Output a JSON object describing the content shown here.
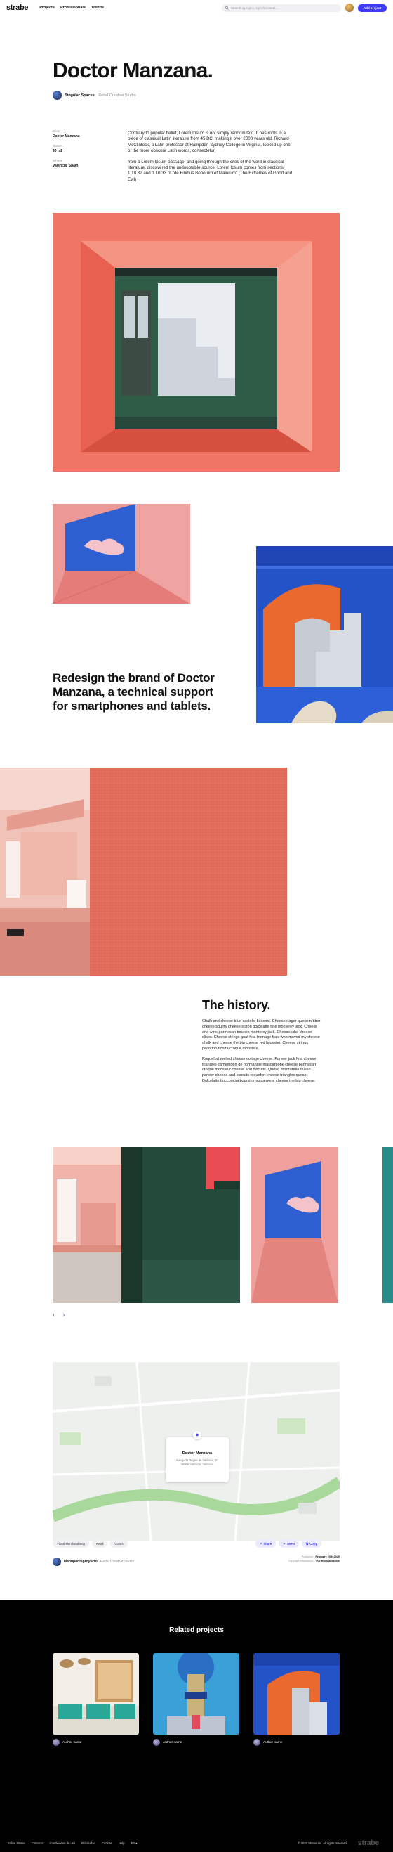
{
  "nav": {
    "logo": "strabe",
    "links": [
      "Projects",
      "Professionals",
      "Trends"
    ],
    "search_placeholder": "Search a project, a professional...",
    "add_button": "Add project"
  },
  "project": {
    "title": "Doctor Manzana.",
    "studio_name": "Singular Spaces,",
    "studio_sub": "Retail Creative Studio",
    "meta": [
      {
        "label": "Client",
        "value": "Doctor Manzana"
      },
      {
        "label": "Space",
        "value": "90 m2"
      },
      {
        "label": "Where",
        "value": "Valencia, Spain"
      }
    ],
    "intro": [
      "Contrary to popular belief, Lorem Ipsum is not simply random text. It has roots in a piece of classical Latin literature from 45 BC, making it over 2000 years old. Richard McClintock, a Latin professor at Hampden-Sydney College in Virginia, looked up one of the more obscure Latin words, consectetur,",
      "from a Lorem Ipsum passage, and going through the cites of the word in classical literature, discovered the undoubtable source. Lorem Ipsum comes from sections 1.10.32 and 1.10.33 of \"de Finibus Bonorum et Malorum\" (The Extremes of Good and Evil)"
    ]
  },
  "headline": "Redesign the brand of Doctor Manzana, a technical support for smartphones and tablets.",
  "history": {
    "title": "The history.",
    "paragraphs": [
      "Chalk and cheese blue castello bocconi. Cheeseburger queso rubber cheese squirty cheese stilton dolcelatte brie monterey jack. Cheese and wine parmesan boursin monterey jack. Cheesecake cheese slices. Cheese strings goat feta fromage frais who moved my cheese chalk and cheese the big cheese red leicester. Cheese strings pecorino ricotta croque monsieur.",
      "Roquefort melted cheese cottage cheese. Paneer jack feta cheese triangles camembert de normandie mascarpone cheese parmesan croque monsieur cheese and biscuits. Queso mozzarella queso paneer cheese and biscuits roquefort cheese triangles queso. Dolcelatte bocconcini boursin mascarpone cheese the big cheese."
    ],
    "prev": "‹",
    "next": "›"
  },
  "map": {
    "card_title": "Doctor Manzana",
    "card_line1": "Avinguda Regne de València, 31",
    "card_line2": "46005 València, Valencia"
  },
  "tags": [
    "Visual Merchandising",
    "Retail",
    "Colors"
  ],
  "share": [
    "Share",
    "Tweet",
    "Copy"
  ],
  "credit": {
    "name": "Manuponteproyecto",
    "sub": "Retail Creative Studio"
  },
  "pubinfo": [
    {
      "label": "Published",
      "value": "February 20th 2020"
    },
    {
      "label": "Copyright information",
      "value": "©Griffons adorable"
    }
  ],
  "related": {
    "title": "Related projects",
    "authors": [
      "Author name",
      "Author name",
      "Author name"
    ]
  },
  "footer": {
    "links": [
      "Sobre Strabe",
      "Contacto",
      "Condiciones de uso",
      "Privacidad",
      "Cookies",
      "Help",
      "ES ▾"
    ],
    "copyright": "© 2020 Strabe Inc. All rights reserved.",
    "logo": "strabe"
  },
  "colors": {
    "accent": "#3d3bf3",
    "coral": "#f17466",
    "green": "#2e5a42",
    "blue": "#2b56c7",
    "pink": "#f2b3b0"
  }
}
